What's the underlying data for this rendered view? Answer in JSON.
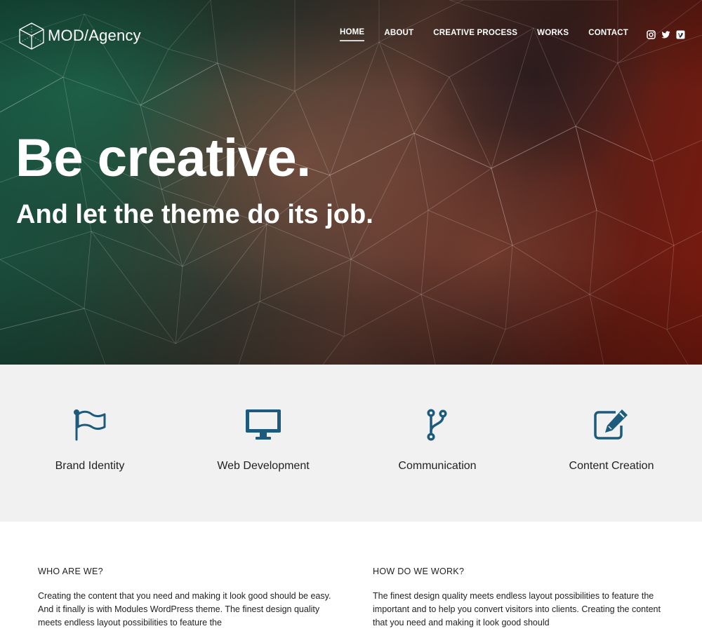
{
  "brand": {
    "name": "MOD/Agency"
  },
  "nav": {
    "items": [
      {
        "label": "HOME",
        "active": true
      },
      {
        "label": "ABOUT",
        "active": false
      },
      {
        "label": "CREATIVE PROCESS",
        "active": false
      },
      {
        "label": "WORKS",
        "active": false
      },
      {
        "label": "CONTACT",
        "active": false
      }
    ],
    "social": [
      "instagram-icon",
      "twitter-icon",
      "vimeo-icon"
    ]
  },
  "hero": {
    "headline": "Be creative.",
    "subheadline": "And let the theme do its job."
  },
  "services": [
    {
      "label": "Brand Identity",
      "icon": "flag-icon"
    },
    {
      "label": "Web Development",
      "icon": "monitor-icon"
    },
    {
      "label": "Communication",
      "icon": "branch-icon"
    },
    {
      "label": "Content Creation",
      "icon": "edit-icon"
    }
  ],
  "about": {
    "left": {
      "title": "WHO ARE WE?",
      "text": "Creating the content that you need and making it look good should be easy. And it finally is with Modules WordPress theme. The finest design quality meets endless layout possibilities to feature the"
    },
    "right": {
      "title": "HOW DO WE WORK?",
      "text": "The finest design quality meets endless layout possibilities to feature the important and to help you convert visitors into clients. Creating the content that you need and making it look good should"
    }
  },
  "colors": {
    "accent": "#1d5b7c",
    "services_bg": "#f1f1f1"
  }
}
